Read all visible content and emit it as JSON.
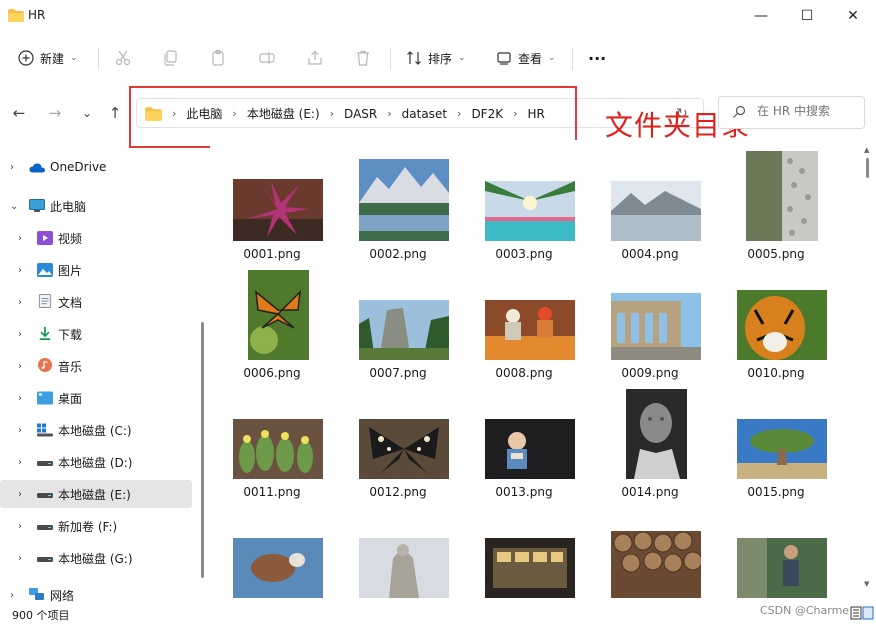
{
  "window": {
    "title": "HR",
    "minimize": "—",
    "maximize": "☐",
    "close": "✕"
  },
  "toolbar": {
    "new_label": "新建",
    "sort_label": "排序",
    "view_label": "查看",
    "more_label": "···"
  },
  "nav": {
    "back": "←",
    "forward": "→",
    "recent": "⌄",
    "up": "↑"
  },
  "breadcrumb": [
    "此电脑",
    "本地磁盘 (E:)",
    "DASR",
    "dataset",
    "DF2K",
    "HR"
  ],
  "breadcrumb_sep": "›",
  "annotation": "文件夹目录",
  "search": {
    "placeholder": "在 HR 中搜索"
  },
  "sidebar": {
    "items": [
      {
        "label": "OneDrive",
        "icon": "cloud-icon"
      },
      {
        "label": "此电脑",
        "icon": "computer-icon"
      },
      {
        "label": "视频",
        "icon": "video-icon"
      },
      {
        "label": "图片",
        "icon": "pictures-icon"
      },
      {
        "label": "文档",
        "icon": "documents-icon"
      },
      {
        "label": "下载",
        "icon": "download-icon"
      },
      {
        "label": "音乐",
        "icon": "music-icon"
      },
      {
        "label": "桌面",
        "icon": "desktop-icon"
      },
      {
        "label": "本地磁盘 (C:)",
        "icon": "windows-drive-icon"
      },
      {
        "label": "本地磁盘 (D:)",
        "icon": "drive-icon"
      },
      {
        "label": "本地磁盘 (E:)",
        "icon": "drive-icon"
      },
      {
        "label": "新加卷 (F:)",
        "icon": "drive-icon"
      },
      {
        "label": "本地磁盘 (G:)",
        "icon": "drive-icon"
      },
      {
        "label": "网络",
        "icon": "network-icon"
      }
    ]
  },
  "files": [
    {
      "name": "0001.png"
    },
    {
      "name": "0002.png"
    },
    {
      "name": "0003.png"
    },
    {
      "name": "0004.png"
    },
    {
      "name": "0005.png"
    },
    {
      "name": "0006.png"
    },
    {
      "name": "0007.png"
    },
    {
      "name": "0008.png"
    },
    {
      "name": "0009.png"
    },
    {
      "name": "0010.png"
    },
    {
      "name": "0011.png"
    },
    {
      "name": "0012.png"
    },
    {
      "name": "0013.png"
    },
    {
      "name": "0014.png"
    },
    {
      "name": "0015.png"
    },
    {
      "name": ""
    },
    {
      "name": ""
    },
    {
      "name": ""
    },
    {
      "name": ""
    },
    {
      "name": ""
    }
  ],
  "status": {
    "item_count": "900 个项目"
  },
  "watermark": "CSDN @Charme",
  "colors": {
    "accent": "#0067c0",
    "folder": "#f4c24c",
    "annotation_red": "#e53935",
    "selected_bg": "#e5e5e5"
  }
}
